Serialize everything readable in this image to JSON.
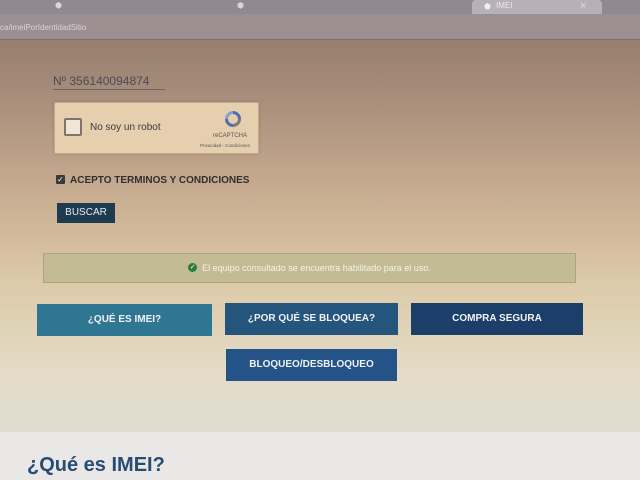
{
  "browser": {
    "tab_active_label": "IMEI",
    "url": "ca/imeiPorIdentidadSitio"
  },
  "form": {
    "imei_value": "Nº 356140094874",
    "recaptcha": {
      "label": "No soy un robot",
      "brand": "reCAPTCHA",
      "links": "Privacidad - Condiciones"
    },
    "terms_label": "ACEPTO TERMINOS Y CONDICIONES",
    "terms_checked": true,
    "search_button": "BUSCAR"
  },
  "status": {
    "message": "El equipo consultado se encuentra habilitado para el uso.",
    "color": "#2e7d3a"
  },
  "buttons": [
    {
      "label": "¿QUÉ ES IMEI?",
      "color": "#2f7693"
    },
    {
      "label": "¿POR QUÉ SE BLOQUEA?",
      "color": "#25557d"
    },
    {
      "label": "COMPRA SEGURA",
      "color": "#1c3f6a"
    },
    {
      "label": "BLOQUEO/DESBLOQUEO",
      "color": "#245487"
    }
  ],
  "section": {
    "title": "¿Qué es IMEI?"
  }
}
